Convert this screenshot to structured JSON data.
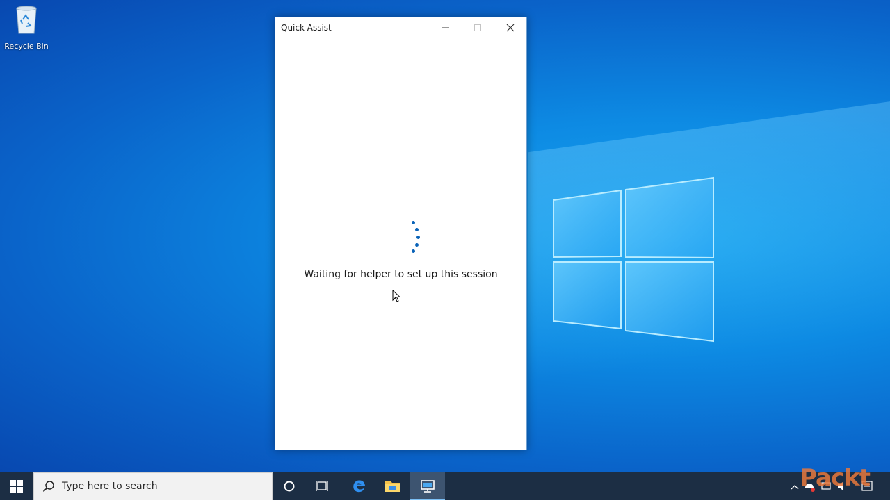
{
  "desktop": {
    "icons": [
      {
        "label": "Recycle Bin",
        "icon": "recycle-bin-icon"
      }
    ]
  },
  "window": {
    "title": "Quick Assist",
    "status_text": "Waiting for helper to set up this session",
    "loading_indicator": "spinner"
  },
  "taskbar": {
    "search_placeholder": "Type here to search",
    "pinned": [
      "cortana-icon",
      "task-view-icon",
      "edge-icon",
      "file-explorer-icon",
      "quick-assist-icon"
    ],
    "active_app": "Quick Assist"
  },
  "watermark": {
    "text": "Packt"
  },
  "colors": {
    "accent": "#0a63b8",
    "taskbar": "#1c2e44",
    "desktop": "#0d8ae3"
  }
}
